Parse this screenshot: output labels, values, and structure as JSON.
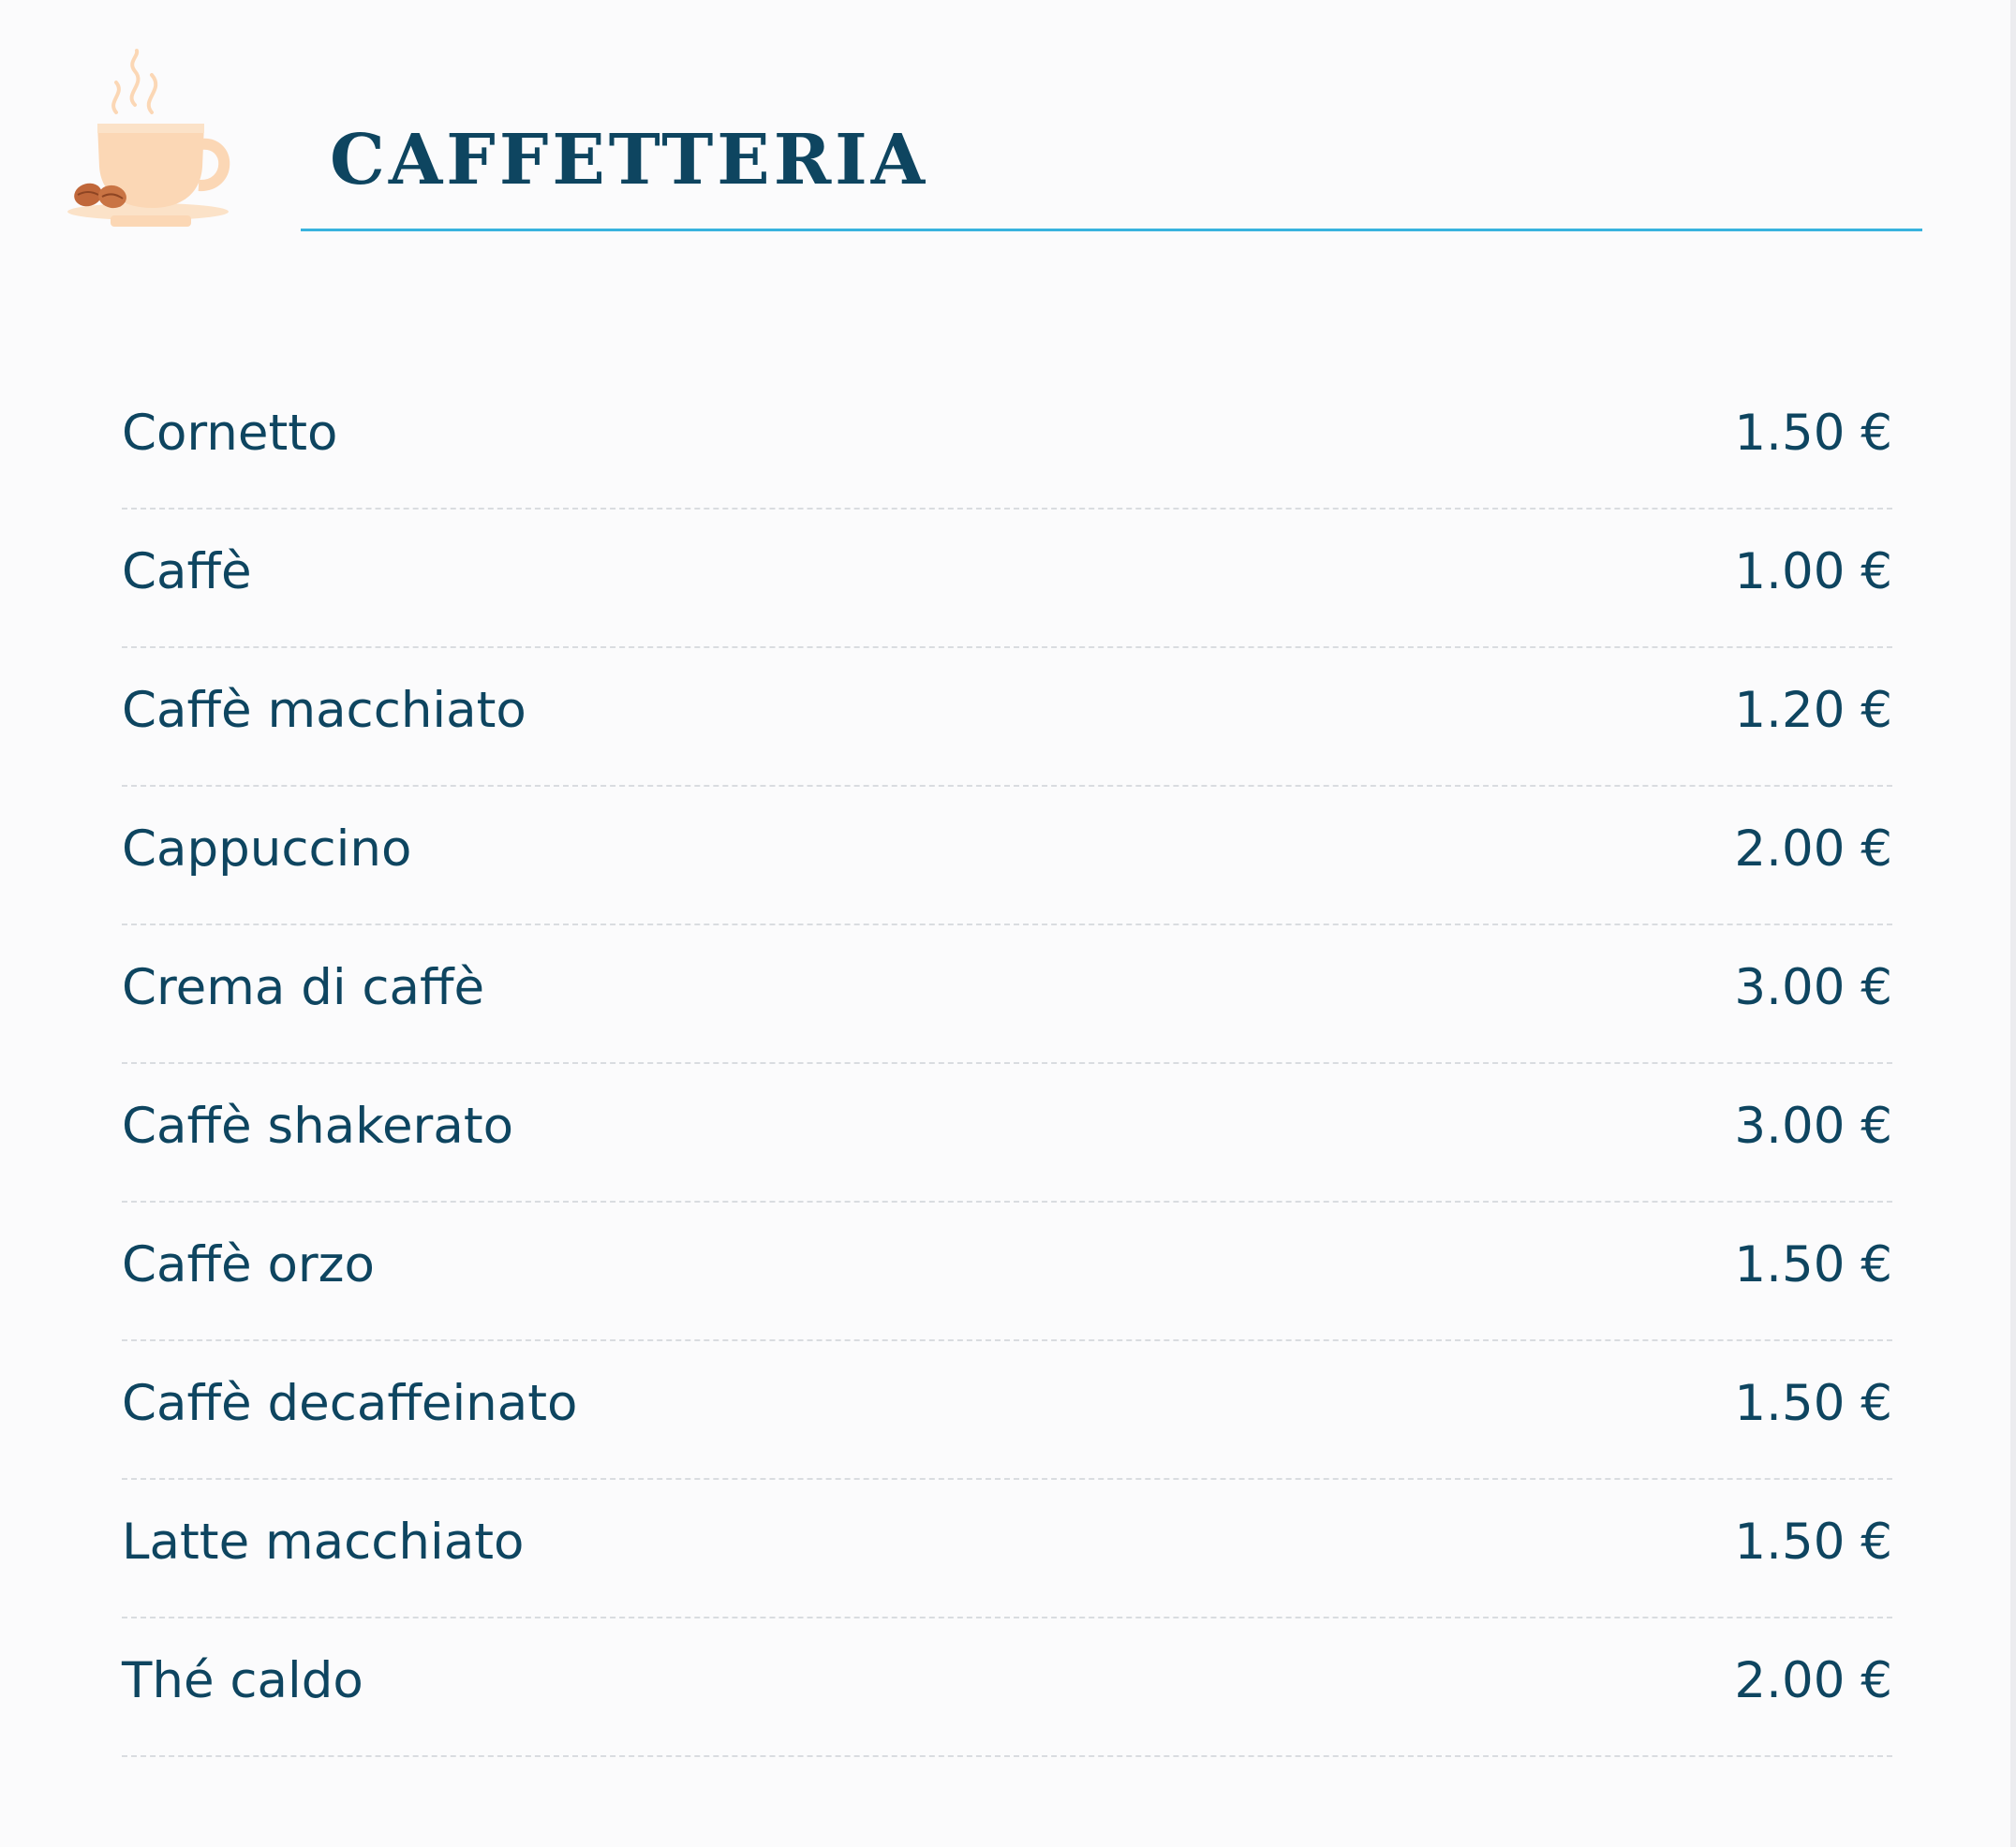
{
  "menu": {
    "title": "CAFFETTERIA",
    "icon": "coffee-cup-icon",
    "colors": {
      "text": "#0e4560",
      "rule": "#38b3de",
      "icon": "#fbd7b5",
      "beans": "#c0673a"
    },
    "items": [
      {
        "name": "Cornetto",
        "price": "1.50 €"
      },
      {
        "name": "Caffè",
        "price": "1.00 €"
      },
      {
        "name": "Caffè macchiato",
        "price": "1.20 €"
      },
      {
        "name": "Cappuccino",
        "price": "2.00 €"
      },
      {
        "name": "Crema di caffè",
        "price": "3.00 €"
      },
      {
        "name": "Caffè shakerato",
        "price": "3.00 €"
      },
      {
        "name": "Caffè orzo",
        "price": "1.50 €"
      },
      {
        "name": "Caffè decaffeinato",
        "price": "1.50 €"
      },
      {
        "name": "Latte macchiato",
        "price": "1.50 €"
      },
      {
        "name": "Thé caldo",
        "price": "2.00 €"
      }
    ]
  }
}
